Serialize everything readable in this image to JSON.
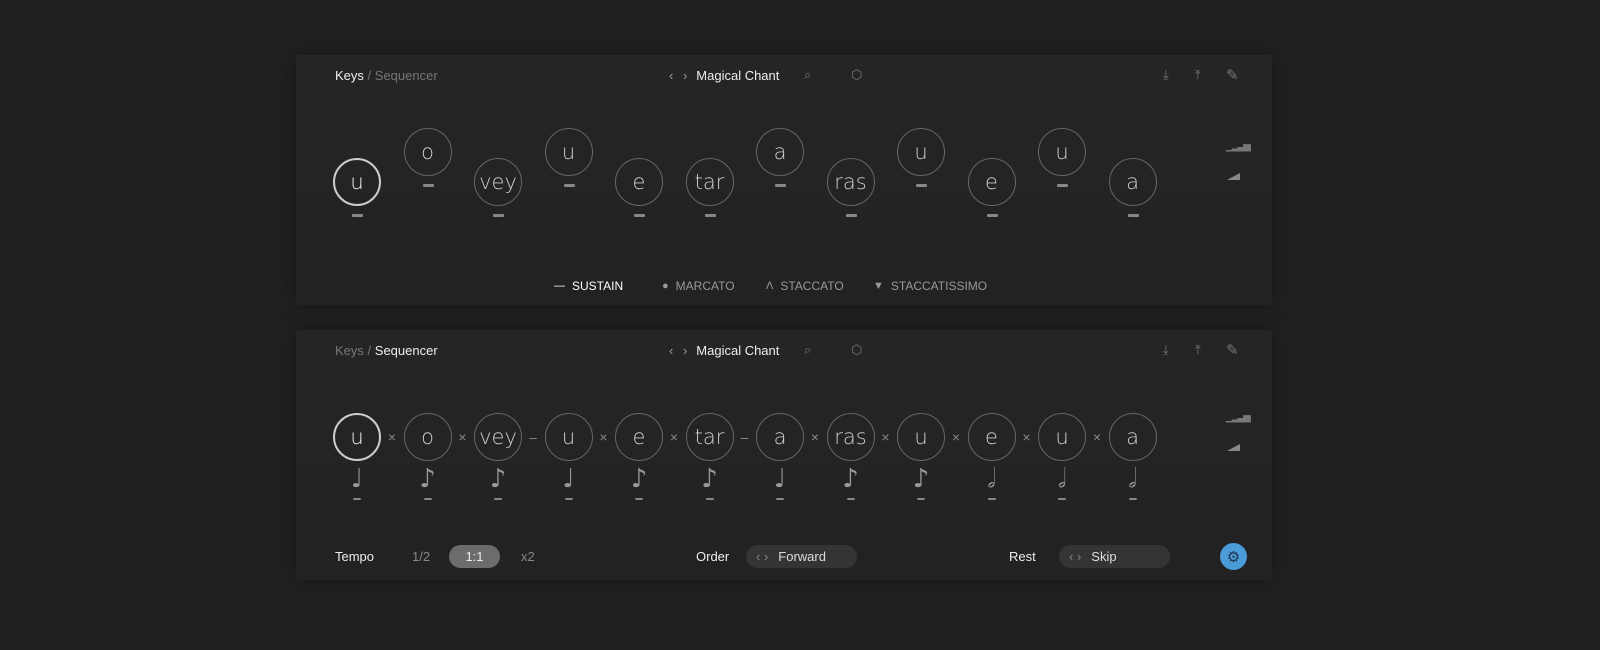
{
  "breadcrumb": {
    "root": "Keys",
    "separator": "/",
    "child": "Sequencer"
  },
  "preset": {
    "name": "Magical Chant",
    "prev": "‹",
    "next": "›"
  },
  "toolbar": {
    "search": "search-icon",
    "random": "dice-icon",
    "import": "download-icon",
    "export": "upload-icon",
    "edit": "pencil-icon"
  },
  "side_icons": [
    "velocity-bars-icon",
    "ramp-icon"
  ],
  "syllables": [
    "u",
    "o",
    "vey",
    "u",
    "e",
    "tar",
    "a",
    "ras",
    "u",
    "e",
    "u",
    "a"
  ],
  "articulation_levels": [
    "low",
    "high",
    "low",
    "high",
    "low",
    "low",
    "high",
    "low",
    "high",
    "low",
    "high",
    "low"
  ],
  "legend": [
    {
      "symbol": "—",
      "label": "SUSTAIN",
      "active": true
    },
    {
      "symbol": "●",
      "label": "MARCATO"
    },
    {
      "symbol": "Λ",
      "label": "STACCATO"
    },
    {
      "symbol": "▼",
      "label": "STACCATISSIMO"
    }
  ],
  "connectors": [
    "×",
    "×",
    "–",
    "×",
    "×",
    "–",
    "×",
    "×",
    "×",
    "×",
    "×"
  ],
  "notes": [
    "quarter",
    "eighth",
    "eighth",
    "quarter",
    "eighth",
    "eighth",
    "quarter",
    "eighth",
    "eighth",
    "half",
    "half",
    "half"
  ],
  "note_glyphs": {
    "quarter": "♩",
    "eighth": "♪",
    "half": "𝅗𝅥"
  },
  "bottom": {
    "tempo_label": "Tempo",
    "tempo_options": [
      "1/2",
      "1:1",
      "x2"
    ],
    "tempo_selected": "1:1",
    "order_label": "Order",
    "order_value": "Forward",
    "rest_label": "Rest",
    "rest_value": "Skip",
    "arrows": "‹ ›",
    "settings": "gear-icon"
  },
  "colors": {
    "accent": "#4a9bd8",
    "background": "#212122"
  }
}
